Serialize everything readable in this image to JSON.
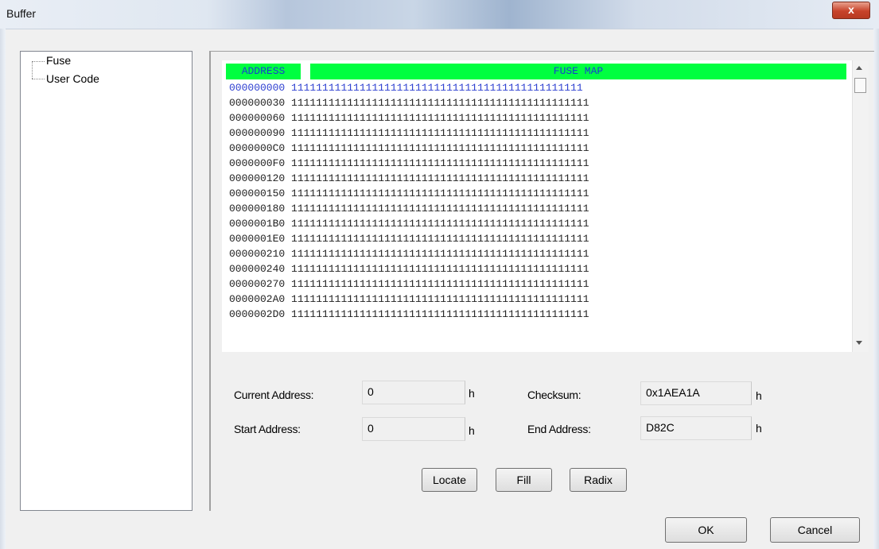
{
  "window": {
    "title": "Buffer",
    "close_label": "x"
  },
  "tree": {
    "items": [
      "Fuse",
      "User Code"
    ]
  },
  "grid": {
    "columns": [
      "ADDRESS",
      "FUSE MAP"
    ],
    "rows": [
      {
        "address": "000000000",
        "data": "11111111111111111111111111111111111111111111111"
      },
      {
        "address": "000000030",
        "data": "111111111111111111111111111111111111111111111111"
      },
      {
        "address": "000000060",
        "data": "111111111111111111111111111111111111111111111111"
      },
      {
        "address": "000000090",
        "data": "111111111111111111111111111111111111111111111111"
      },
      {
        "address": "0000000C0",
        "data": "111111111111111111111111111111111111111111111111"
      },
      {
        "address": "0000000F0",
        "data": "111111111111111111111111111111111111111111111111"
      },
      {
        "address": "000000120",
        "data": "111111111111111111111111111111111111111111111111"
      },
      {
        "address": "000000150",
        "data": "111111111111111111111111111111111111111111111111"
      },
      {
        "address": "000000180",
        "data": "111111111111111111111111111111111111111111111111"
      },
      {
        "address": "0000001B0",
        "data": "111111111111111111111111111111111111111111111111"
      },
      {
        "address": "0000001E0",
        "data": "111111111111111111111111111111111111111111111111"
      },
      {
        "address": "000000210",
        "data": "111111111111111111111111111111111111111111111111"
      },
      {
        "address": "000000240",
        "data": "111111111111111111111111111111111111111111111111"
      },
      {
        "address": "000000270",
        "data": "111111111111111111111111111111111111111111111111"
      },
      {
        "address": "0000002A0",
        "data": "111111111111111111111111111111111111111111111111"
      },
      {
        "address": "0000002D0",
        "data": "111111111111111111111111111111111111111111111111"
      }
    ],
    "header_color": "#00ff40",
    "header_text_color": "#1640d0"
  },
  "form": {
    "current_address": {
      "label": "Current Address:",
      "value": "0",
      "unit": "h"
    },
    "checksum": {
      "label": "Checksum:",
      "value": "0x1AEA1A",
      "unit": "h"
    },
    "start_address": {
      "label": "Start Address:",
      "value": "0",
      "unit": "h"
    },
    "end_address": {
      "label": "End Address:",
      "value": "D82C",
      "unit": "h"
    }
  },
  "buttons": {
    "locate": "Locate",
    "fill": "Fill",
    "radix": "Radix",
    "ok": "OK",
    "cancel": "Cancel"
  }
}
